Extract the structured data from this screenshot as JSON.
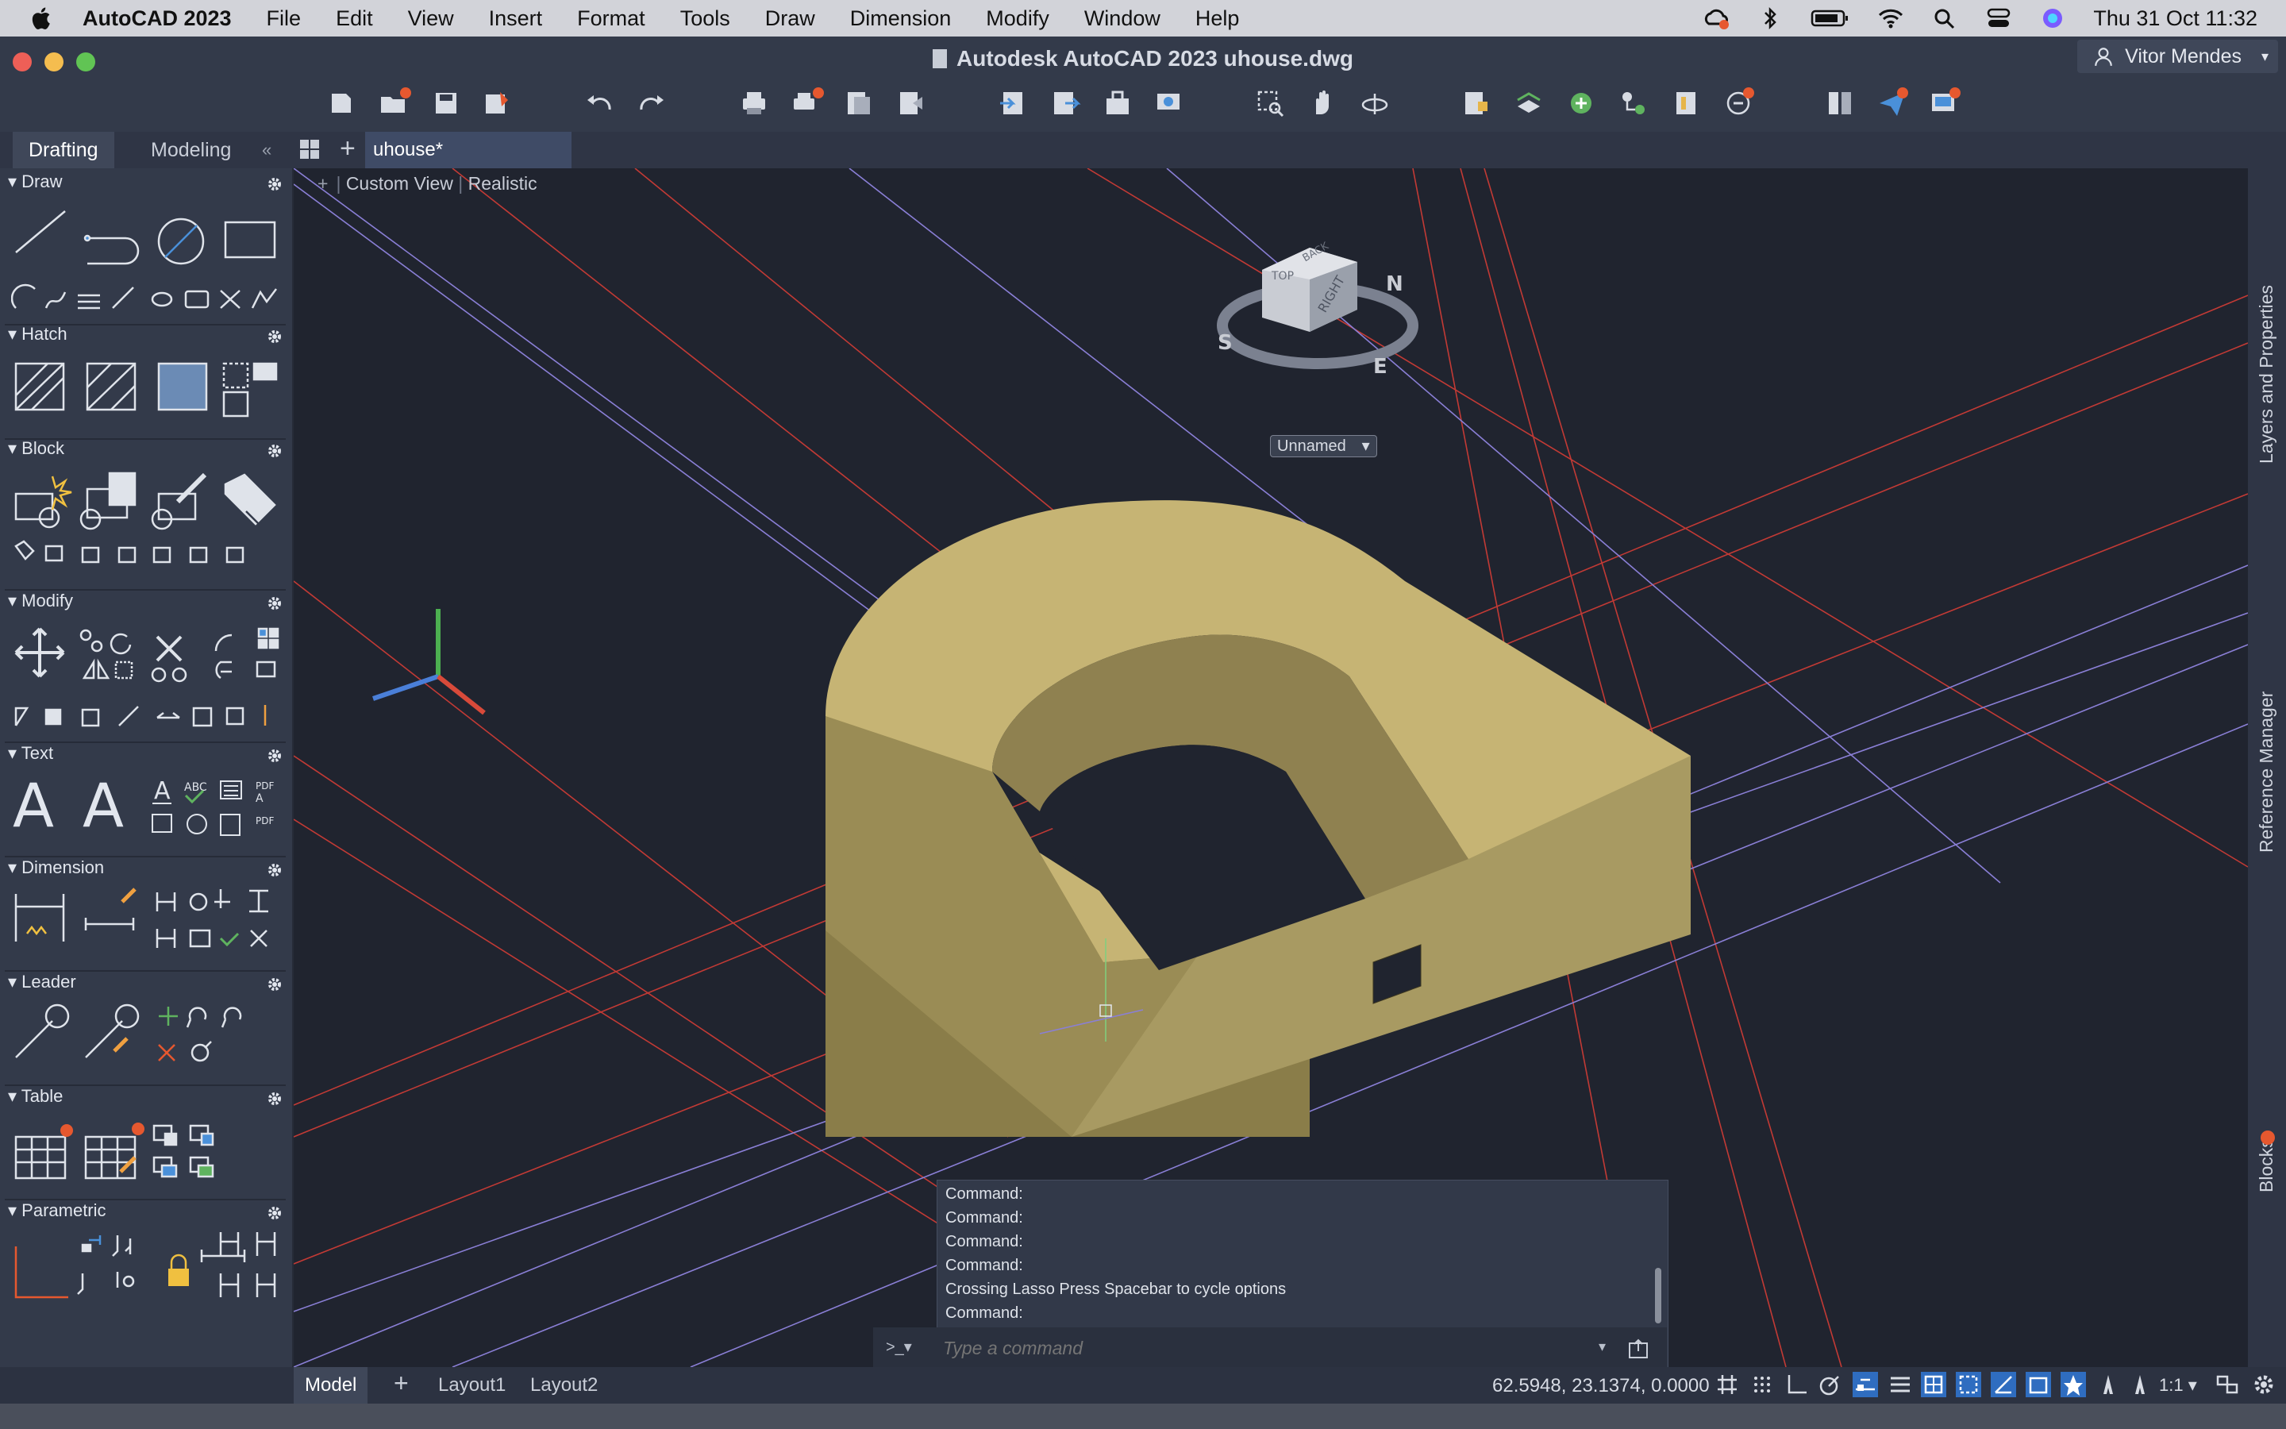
{
  "menubar": {
    "app_name": "AutoCAD 2023",
    "items": [
      "File",
      "Edit",
      "View",
      "Insert",
      "Format",
      "Tools",
      "Draw",
      "Dimension",
      "Modify",
      "Window",
      "Help"
    ],
    "clock": "Thu 31 Oct  11:32"
  },
  "window": {
    "title": "Autodesk AutoCAD 2023    uhouse.dwg",
    "user": "Vitor Mendes"
  },
  "palette_tabs": [
    "Drafting",
    "Modeling"
  ],
  "doc_tab": "uhouse*",
  "sections": [
    "Draw",
    "Hatch",
    "Block",
    "Modify",
    "Text",
    "Dimension",
    "Leader",
    "Table",
    "Parametric"
  ],
  "viewport": {
    "view": "Custom View",
    "style": "Realistic",
    "viewcube_faces": [
      "TOP",
      "RIGHT",
      "BACK"
    ],
    "compass": [
      "S",
      "N",
      "E"
    ],
    "ucs_name": "Unnamed"
  },
  "right_panels": [
    "Layers and Properties",
    "Reference Manager",
    "Blocks"
  ],
  "command": {
    "history": [
      "Command:",
      "Command:",
      "Command:",
      "Command:",
      "Crossing Lasso  Press Spacebar to cycle options",
      "Command:"
    ],
    "placeholder": "Type a command"
  },
  "layouts": [
    "Model",
    "Layout1",
    "Layout2"
  ],
  "status": {
    "coords": "62.5948, 23.1374, 0.0000",
    "scale": "1:1"
  },
  "colors": {
    "accent": "#e6582f",
    "solid": "#c9b574",
    "axis_red": "#c23a35",
    "axis_purple": "#8a7fd6"
  }
}
